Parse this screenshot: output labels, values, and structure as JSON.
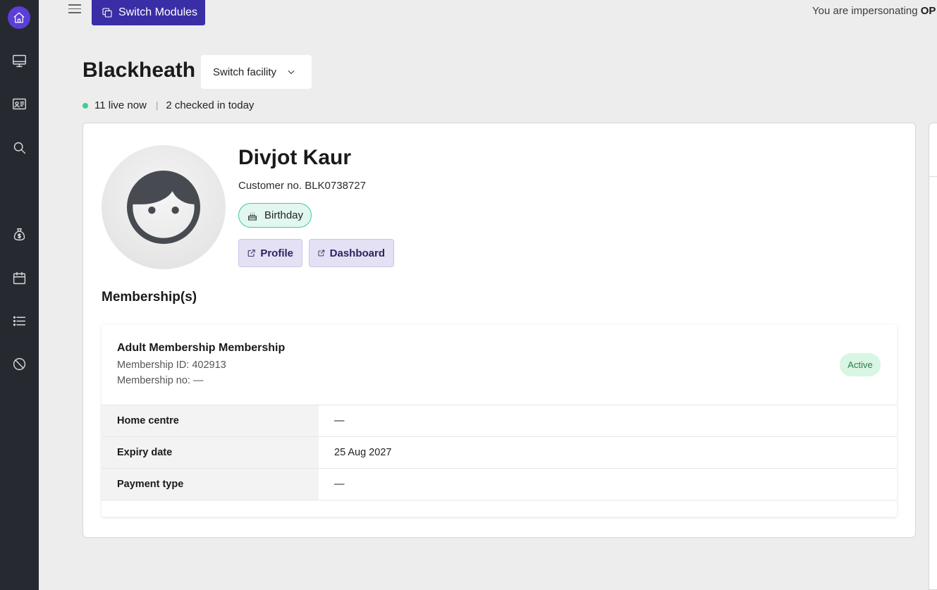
{
  "topbar": {
    "switch_modules_label": "Switch Modules",
    "impersonation_text": "You are impersonating",
    "impersonated_user": "OP"
  },
  "sidebar": {
    "icons": [
      "home-icon",
      "monitor-icon",
      "id-card-icon",
      "search-icon",
      "money-bag-icon",
      "calendar-icon",
      "list-icon",
      "block-icon"
    ]
  },
  "facility": {
    "name": "Blackheath",
    "switch_label": "Switch facility",
    "live_now": "11 live now",
    "separator": "|",
    "checked_in": "2 checked in today"
  },
  "customer": {
    "name": "Divjot Kaur",
    "customer_no": "Customer no. BLK0738727",
    "badge": "Birthday",
    "profile_label": "Profile",
    "dashboard_label": "Dashboard"
  },
  "memberships": {
    "section_title": "Membership(s)",
    "items": [
      {
        "name": "Adult Membership Membership",
        "membership_id": "Membership ID: 402913",
        "membership_no": "Membership no: —",
        "status": "Active",
        "rows": [
          {
            "label": "Home centre",
            "value": "—"
          },
          {
            "label": "Expiry date",
            "value": "25 Aug 2027"
          },
          {
            "label": "Payment type",
            "value": "—"
          }
        ]
      }
    ]
  },
  "colors": {
    "sidebar_bg": "#262a30",
    "accent": "#3a2ea6",
    "home_active": "#5b3fd6",
    "live_dot": "#3fcf8e",
    "status_active_bg": "#d9f5e4"
  }
}
